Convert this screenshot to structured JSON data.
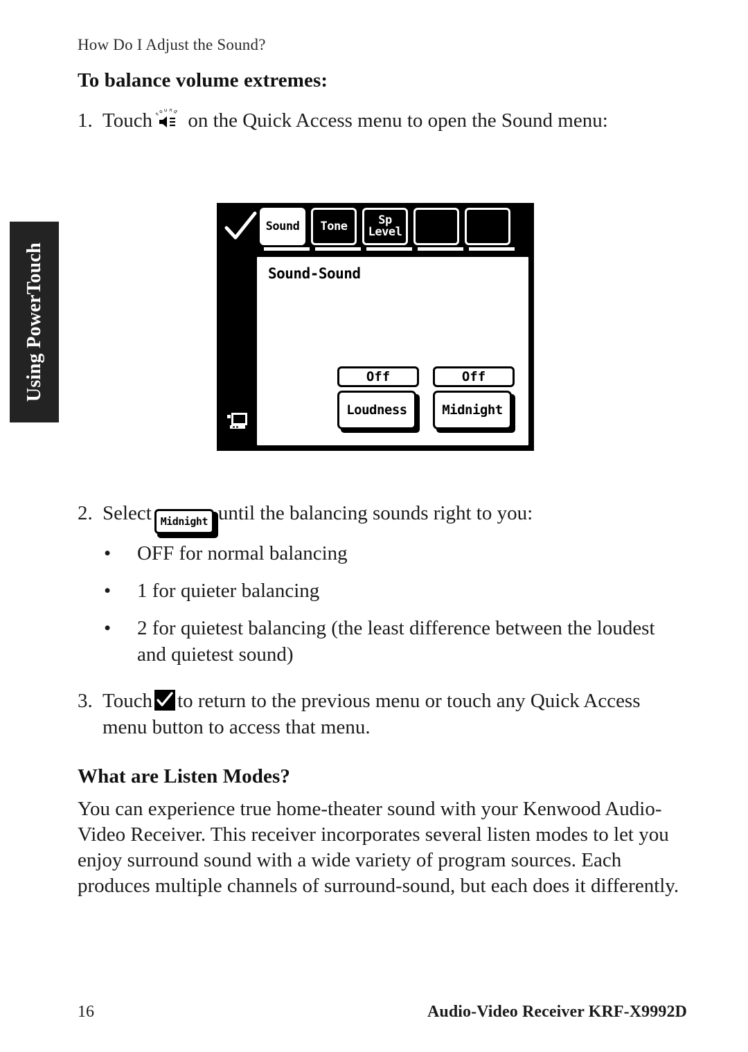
{
  "side_tab": {
    "label": "Using PowerTouch"
  },
  "running_head": "How Do I Adjust the Sound?",
  "headings": {
    "balance": "To balance volume extremes:",
    "listen_modes": "What are Listen Modes?"
  },
  "steps": {
    "step1": {
      "number": "1.",
      "text_before": "Touch",
      "icon": "sound-speaker-icon",
      "text_after": "on the Quick Access menu to open the Sound menu:"
    },
    "step2": {
      "number": "2.",
      "text_before": "Select",
      "button_label": "Midnight",
      "text_after": "until the balancing sounds right to you:"
    },
    "step3": {
      "number": "3.",
      "text_before": "Touch",
      "icon": "check-button-icon",
      "text_after": "to return to the previous menu or touch any Quick Access menu button to access that menu."
    }
  },
  "bullets": [
    {
      "dot": "•",
      "text": "OFF for normal balancing"
    },
    {
      "dot": "•",
      "text": "1 for quieter balancing"
    },
    {
      "dot": "•",
      "text": "2 for quietest balancing (the least difference between the loudest and quietest sound)"
    }
  ],
  "paragraph": "You can experience true home-theater sound with your Kenwood Audio-Video Receiver. This receiver incorporates several listen modes to let you enjoy surround sound with a wide variety of program sources. Each produces multiple channels of surround-sound, but each does it differently.",
  "lcd_figure": {
    "checkmark_icon": "check-icon",
    "monitor_icon": "monitor-icon",
    "tabs": [
      {
        "label": "Sound",
        "selected": true
      },
      {
        "label": "Tone",
        "selected": false
      },
      {
        "label": "Sp\nLevel",
        "selected": false
      },
      {
        "label": "",
        "selected": false
      },
      {
        "label": "",
        "selected": false
      }
    ],
    "tab_labels": {
      "t0": "Sound",
      "t1": "Tone",
      "t2_line1": "Sp",
      "t2_line2": "Level"
    },
    "panel_title": "Sound-Sound",
    "controls": [
      {
        "value": "Off",
        "label": "Loudness"
      },
      {
        "value": "Off",
        "label": "Midnight"
      }
    ],
    "control_values": {
      "loudness_value": "Off",
      "loudness_label": "Loudness",
      "midnight_value": "Off",
      "midnight_label": "Midnight"
    }
  },
  "footer": {
    "page_number": "16",
    "model": "Audio-Video Receiver KRF-X9992D"
  },
  "colors": {
    "ink": "#1a1a1a",
    "side_tab_bg": "#232323",
    "lcd_bg": "#000000",
    "lcd_screen": "#ffffff"
  }
}
